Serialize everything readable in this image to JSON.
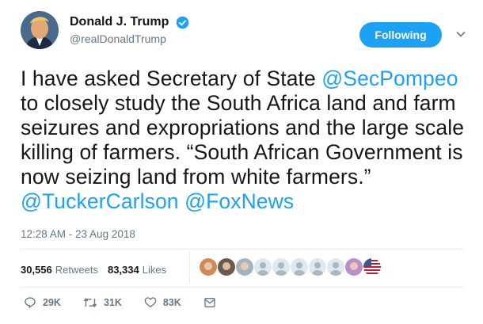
{
  "user": {
    "display_name": "Donald J. Trump",
    "handle": "@realDonaldTrump",
    "verified": true
  },
  "follow_button": {
    "label": "Following"
  },
  "tweet": {
    "segments": [
      {
        "text": "I have asked Secretary of State ",
        "mention": false
      },
      {
        "text": "@SecPompeo",
        "mention": true
      },
      {
        "text": " to closely study the South Africa land and farm seizures and expropriations and the large scale killing of farmers. “South African Government is now seizing land from white farmers.” ",
        "mention": false
      },
      {
        "text": "@TuckerCarlson",
        "mention": true
      },
      {
        "text": " ",
        "mention": false
      },
      {
        "text": "@FoxNews",
        "mention": true
      }
    ]
  },
  "timestamp": "12:28 AM - 23 Aug 2018",
  "stats": {
    "retweets_count": "30,556",
    "retweets_label": "Retweets",
    "likes_count": "83,334",
    "likes_label": "Likes"
  },
  "liker_avatars": [
    {
      "type": "photo",
      "color": "#d08b5b"
    },
    {
      "type": "photo",
      "color": "#6d5a4f"
    },
    {
      "type": "photo",
      "color": "#a7b4c0"
    },
    {
      "type": "default",
      "color": "#aab8c2"
    },
    {
      "type": "default",
      "color": "#aab8c2"
    },
    {
      "type": "default",
      "color": "#aab8c2"
    },
    {
      "type": "default",
      "color": "#aab8c2"
    },
    {
      "type": "default",
      "color": "#aab8c2"
    },
    {
      "type": "photo",
      "color": "#b98fc9"
    },
    {
      "type": "flag",
      "color": "#3b5998"
    }
  ],
  "actions": {
    "replies": "29K",
    "retweets": "31K",
    "likes": "83K"
  },
  "colors": {
    "accent": "#1da1f2",
    "text": "#14171a",
    "muted": "#657786"
  },
  "icons": [
    "verified-badge-icon",
    "chevron-down-icon",
    "reply-icon",
    "retweet-icon",
    "heart-icon",
    "direct-message-icon"
  ]
}
